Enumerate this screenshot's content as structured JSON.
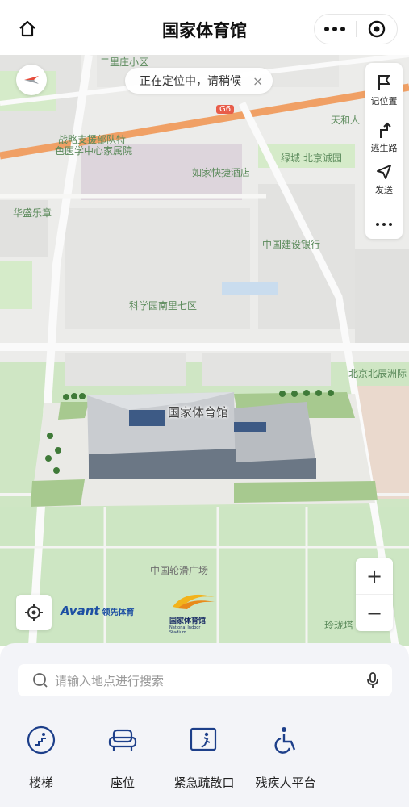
{
  "header": {
    "title": "国家体育馆"
  },
  "map": {
    "toast": {
      "text": "正在定位中，请稍候"
    },
    "side_panel": {
      "items": [
        {
          "label": "记位置",
          "icon": "flag-icon"
        },
        {
          "label": "逃生路",
          "icon": "route-icon"
        },
        {
          "label": "发送",
          "icon": "send-icon"
        }
      ]
    },
    "labels": {
      "l1": "二里庄小区",
      "l2": "G6",
      "l3": "天和人",
      "l4": "战略支援部队特",
      "l5": "色医学中心家属院",
      "l6": "绿城 北京诚园",
      "l7": "如家快捷酒店",
      "l8": "华盛乐章",
      "l9": "中国建设银行",
      "l10": "科学园南里七区",
      "l11": "北京北辰洲际",
      "l12": "中国轮滑广场",
      "l13": "玲珑塔"
    },
    "venue_label": "国家体育馆",
    "logos": {
      "avant": "Avant",
      "avant_cn": "领先体育",
      "nis_name": "国家体育馆",
      "nis_sub": "National Indoor Stadium"
    },
    "zoom": {
      "in": "+",
      "out": "−"
    }
  },
  "sheet": {
    "search_placeholder": "请输入地点进行搜索",
    "features": [
      {
        "label": "楼梯",
        "icon": "stairs-icon"
      },
      {
        "label": "座位",
        "icon": "seat-icon"
      },
      {
        "label": "紧急疏散口",
        "icon": "emergency-exit-icon"
      },
      {
        "label": "残疾人平台",
        "icon": "wheelchair-icon"
      }
    ]
  },
  "colors": {
    "accent": "#1d4fa3",
    "road_orange": "#f0a065",
    "green_area": "#cfe6c4"
  }
}
